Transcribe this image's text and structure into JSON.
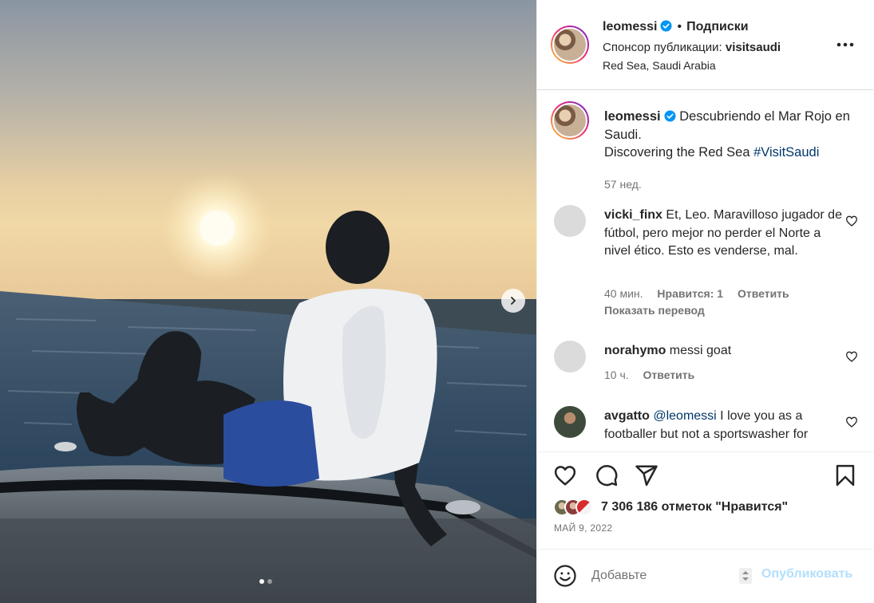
{
  "photo": {
    "next_icon": "chevron-right-icon",
    "carousel_dots": 2,
    "active_dot": 1
  },
  "header": {
    "username": "leomessi",
    "verified_icon": "verified-badge-icon",
    "separator": "•",
    "follow_label": "Подписки",
    "sponsor_prefix": "Спонсор публикации:",
    "sponsor_name": "visitsaudi",
    "location": "Red Sea, Saudi Arabia",
    "more_icon": "more-options-icon"
  },
  "caption": {
    "username": "leomessi",
    "text_line1": "Descubriendo el Mar Rojo en Saudi.",
    "text_line2": "Discovering the Red Sea ",
    "hashtag": "#VisitSaudi",
    "time": "57 нед."
  },
  "comments": [
    {
      "username": "vicki_finx",
      "text": "Et, Leo. Maravilloso jugador de fútbol, pero mejor no perder el Norte a nivel ético. Esto es venderse, mal.",
      "time": "40 мин.",
      "likes": "Нравится: 1",
      "reply": "Ответить",
      "translate": "Показать перевод"
    },
    {
      "username": "norahymo",
      "text": "messi goat",
      "time": "10 ч.",
      "reply": "Ответить"
    },
    {
      "username": "avgatto",
      "mention": "@leomessi",
      "text": " I love you as a footballer but not a sportswasher for"
    }
  ],
  "actions": {
    "like_icon": "heart-icon",
    "comment_icon": "comment-bubble-icon",
    "share_icon": "paper-plane-icon",
    "save_icon": "bookmark-icon",
    "likes_text": "7 306 186 отметок \"Нравится\"",
    "date": "МАЙ 9, 2022"
  },
  "compose": {
    "emoji_icon": "emoji-smiley-icon",
    "placeholder": "Добавьте",
    "publish_label": "Опубликовать"
  },
  "colors": {
    "link": "#00376b",
    "verified": "#0095f6",
    "publish_disabled": "#b2dffc",
    "muted": "#737373"
  }
}
